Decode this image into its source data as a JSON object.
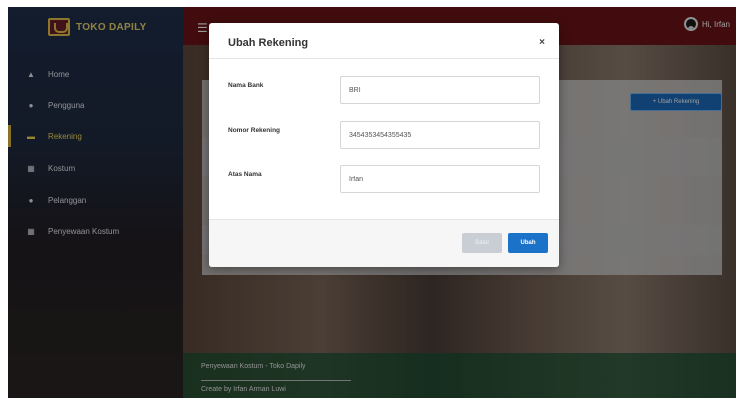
{
  "brand": {
    "name": "TOKO DAPILY"
  },
  "sidebar": {
    "items": [
      {
        "label": "Home",
        "icon": "home-icon"
      },
      {
        "label": "Pengguna",
        "icon": "user-icon"
      },
      {
        "label": "Rekening",
        "icon": "card-icon",
        "active": true
      },
      {
        "label": "Kostum",
        "icon": "table-icon"
      },
      {
        "label": "Pelanggan",
        "icon": "users-icon"
      },
      {
        "label": "Penyewaan Kostum",
        "icon": "list-icon"
      }
    ]
  },
  "topbar": {
    "user_label": "Hi, Irfan"
  },
  "main": {
    "add_button_label": "+ Ubah Rekening"
  },
  "footer": {
    "line1": "Penyewaan Kostum - Toko Dapily",
    "line2": "Create by Irfan Arman Luwi"
  },
  "modal": {
    "title": "Ubah Rekening",
    "close_symbol": "×",
    "fields": [
      {
        "label": "Nama Bank",
        "value": "BRI"
      },
      {
        "label": "Nomor Rekening",
        "value": "3454353454355435"
      },
      {
        "label": "Atas Nama",
        "value": "Irfan"
      }
    ],
    "cancel_label": "Batal",
    "submit_label": "Ubah"
  },
  "colors": {
    "topbar": "#6b1418",
    "accent_yellow": "#f3da5a",
    "primary_blue": "#1a73c9"
  }
}
